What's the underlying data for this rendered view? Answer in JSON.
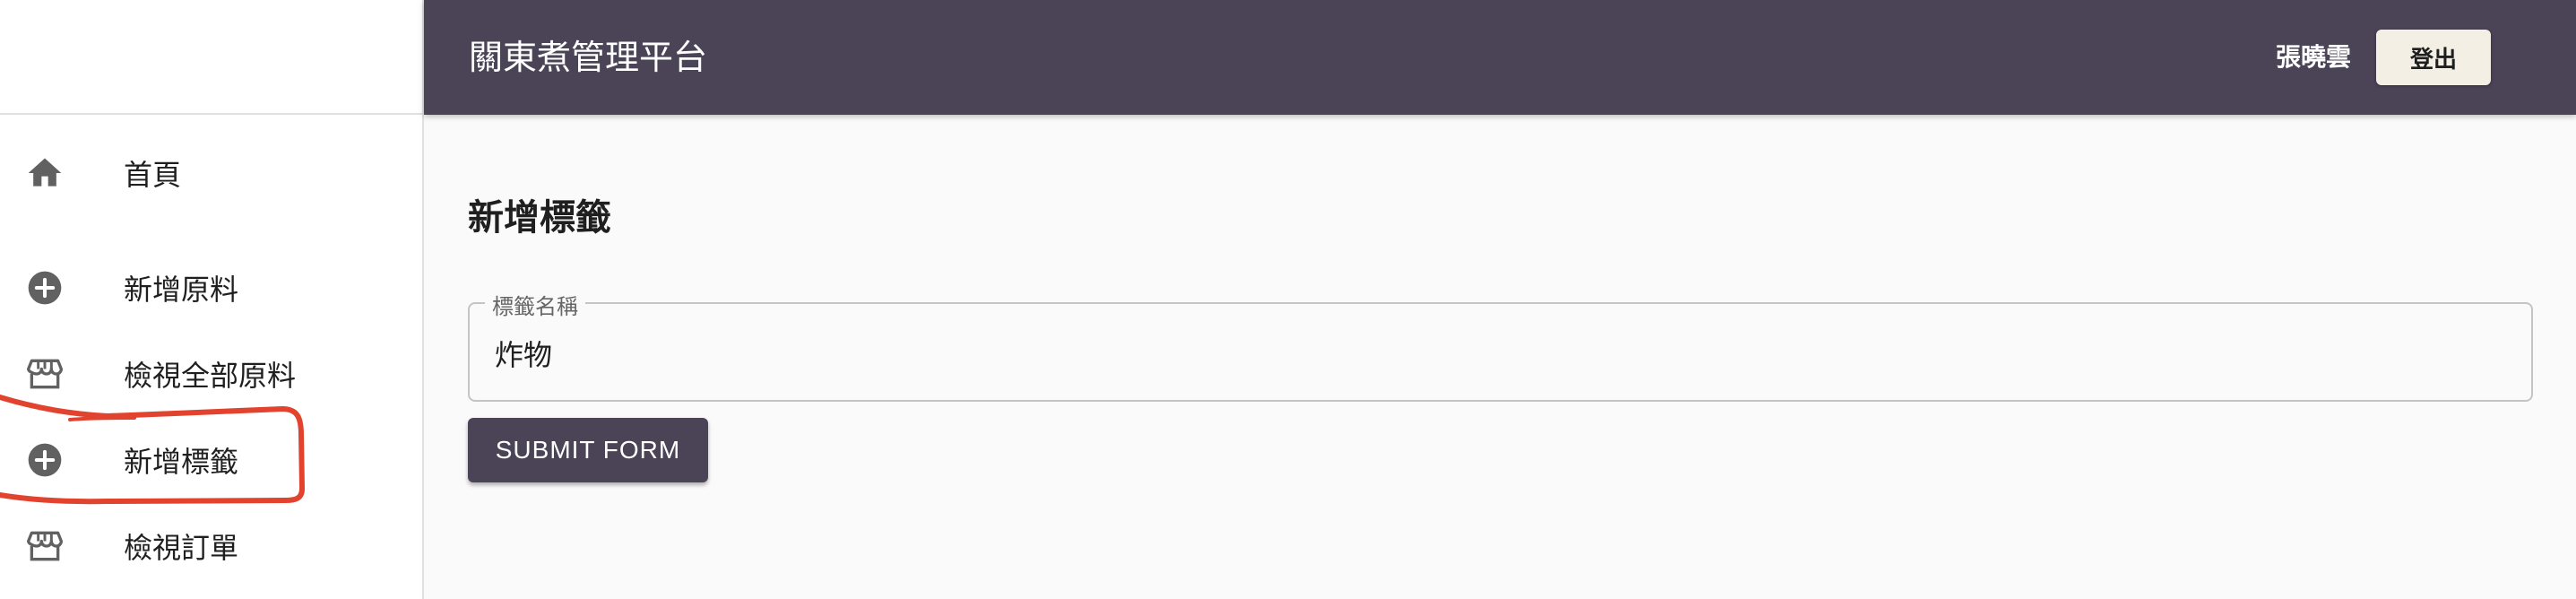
{
  "sidebar": {
    "items": [
      {
        "label": "首頁",
        "icon": "home-icon"
      },
      {
        "label": "新增原料",
        "icon": "add-circle-icon"
      },
      {
        "label": "檢視全部原料",
        "icon": "storefront-icon"
      },
      {
        "label": "新增標籤",
        "icon": "add-circle-icon"
      },
      {
        "label": "檢視訂單",
        "icon": "storefront-icon"
      }
    ]
  },
  "header": {
    "title": "關東煮管理平台",
    "user_name": "張曉雲",
    "logout_label": "登出"
  },
  "main": {
    "title": "新增標籤",
    "field_label": "標籤名稱",
    "field_value": "炸物",
    "submit_label": "SUBMIT FORM"
  },
  "colors": {
    "header_bg": "#4b4356",
    "logout_bg": "#f4efe4",
    "annotation_red": "#e2432e"
  }
}
